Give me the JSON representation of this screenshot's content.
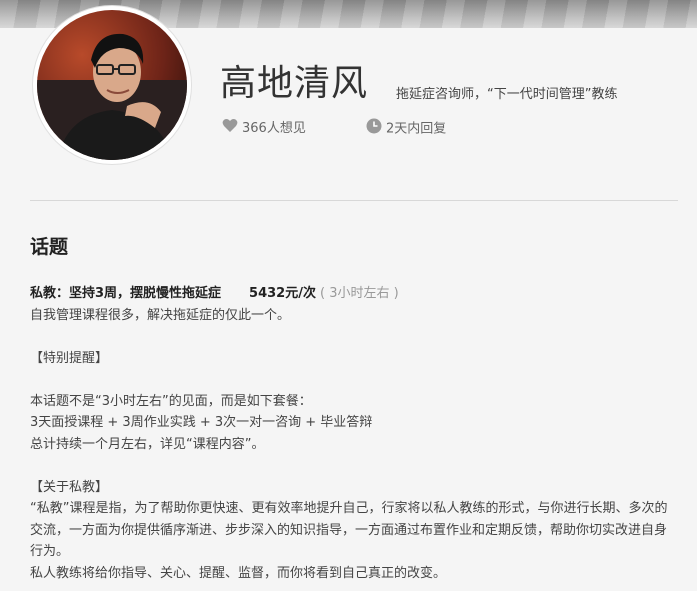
{
  "profile": {
    "name": "高地清风",
    "tagline": "拖延症咨询师，“下一代时间管理”教练",
    "want_count": "366人想见",
    "reply_time": "2天内回复"
  },
  "section": {
    "title": "话题"
  },
  "topic": {
    "title": "私教：坚持3周，摆脱慢性拖延症",
    "price": "5432元/次",
    "duration": "( 3小时左右 )",
    "lines": [
      "自我管理课程很多，解决拖延症的仅此一个。",
      "",
      "【特别提醒】",
      "",
      "本话题不是“3小时左右”的见面，而是如下套餐：",
      "3天面授课程 + 3周作业实践 + 3次一对一咨询 + 毕业答辩",
      "总计持续一个月左右，详见“课程内容”。",
      "",
      "【关于私教】",
      "“私教”课程是指，为了帮助你更快速、更有效率地提升自己，行家将以私人教练的形式，与你进行长期、多次的交流，一方面为你提供循序渐进、步步深入的知识指导，一方面通过布置作业和定期反馈，帮助你切实改进自身行为。",
      "私人教练将给你指导、关心、提醒、监督，而你将看到自己真正的改变。"
    ]
  },
  "colors": {
    "background": "#f5f5f5",
    "icon": "#999999",
    "title_text": "#333333"
  },
  "icons": {
    "want": "heart-icon",
    "reply": "clock-icon"
  }
}
